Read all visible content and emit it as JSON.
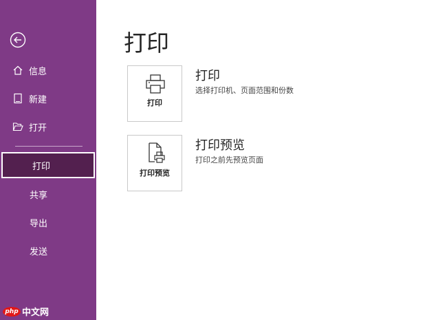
{
  "sidebar": {
    "back_icon": "back-arrow-icon",
    "items": [
      {
        "label": "信息",
        "icon": "home-icon"
      },
      {
        "label": "新建",
        "icon": "new-document-icon"
      },
      {
        "label": "打开",
        "icon": "open-folder-icon"
      },
      {
        "label": "打印",
        "selected": true
      },
      {
        "label": "共享"
      },
      {
        "label": "导出"
      },
      {
        "label": "发送"
      }
    ]
  },
  "watermark": {
    "badge": "php",
    "text": "中文网"
  },
  "main": {
    "title": "打印",
    "options": [
      {
        "tile_label": "打印",
        "title": "打印",
        "description": "选择打印机、页面范围和份数",
        "icon": "printer-icon"
      },
      {
        "tile_label": "打印预览",
        "title": "打印预览",
        "description": "打印之前先预览页面",
        "icon": "print-preview-icon"
      }
    ]
  },
  "colors": {
    "sidebar": "#7f3a86",
    "selected": "#53204f",
    "text": "#262626"
  }
}
